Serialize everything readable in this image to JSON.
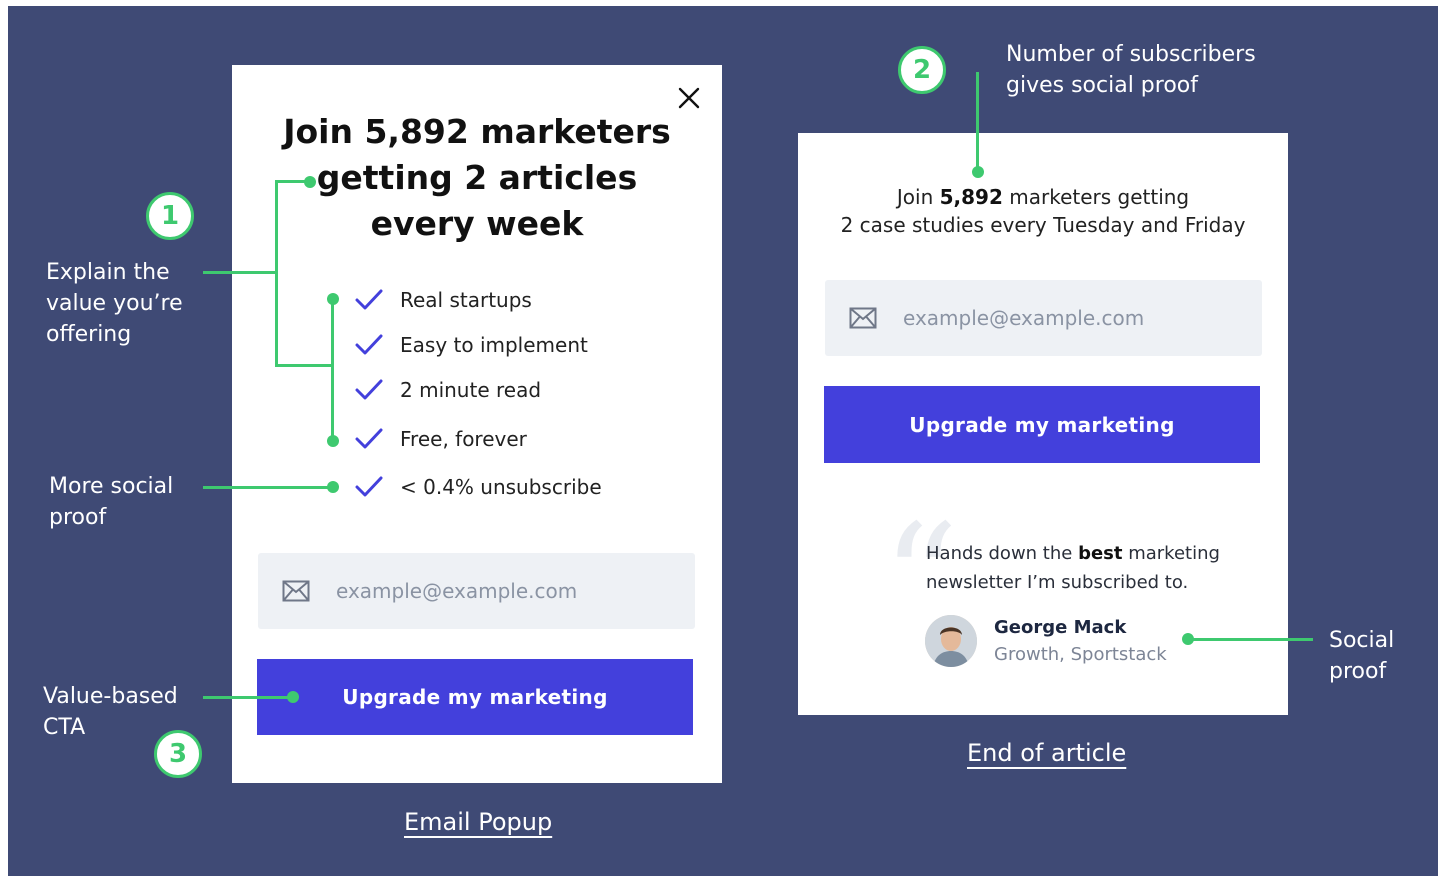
{
  "annotations": {
    "explain": "Explain the\nvalue you’re\noffering",
    "more_social": "More social\nproof",
    "value_cta": "Value-based\nCTA",
    "subscribers": "Number of subscribers\ngives social proof",
    "social": "Social\nproof",
    "badges": [
      "1",
      "2",
      "3"
    ]
  },
  "popup": {
    "title": "Join 5,892 marketers\ngetting 2 articles\nevery week",
    "checklist": [
      "Real startups",
      "Easy to implement",
      "2 minute read",
      "Free, forever",
      "< 0.4% unsubscribe"
    ],
    "email_placeholder": "example@example.com",
    "cta_label": "Upgrade my marketing",
    "caption": "Email Popup",
    "icons": [
      "close-icon",
      "check-icon",
      "mail-icon"
    ]
  },
  "article": {
    "intro_prefix": "Join ",
    "intro_count": "5,892",
    "intro_suffix": " marketers getting",
    "intro_line2": "2 case studies every Tuesday and Friday",
    "email_placeholder": "example@example.com",
    "cta_label": "Upgrade my marketing",
    "quote_pre": "Hands down the ",
    "quote_bold": "best",
    "quote_post": " marketing",
    "quote_line2": "newsletter I’m subscribed to.",
    "author_name": "George Mack",
    "author_role": "Growth, Sportstack",
    "caption": "End of article"
  },
  "colors": {
    "background": "#3f4a75",
    "accent_green": "#3ec96f",
    "cta_blue": "#4340dc",
    "input_bg": "#eef1f5"
  }
}
